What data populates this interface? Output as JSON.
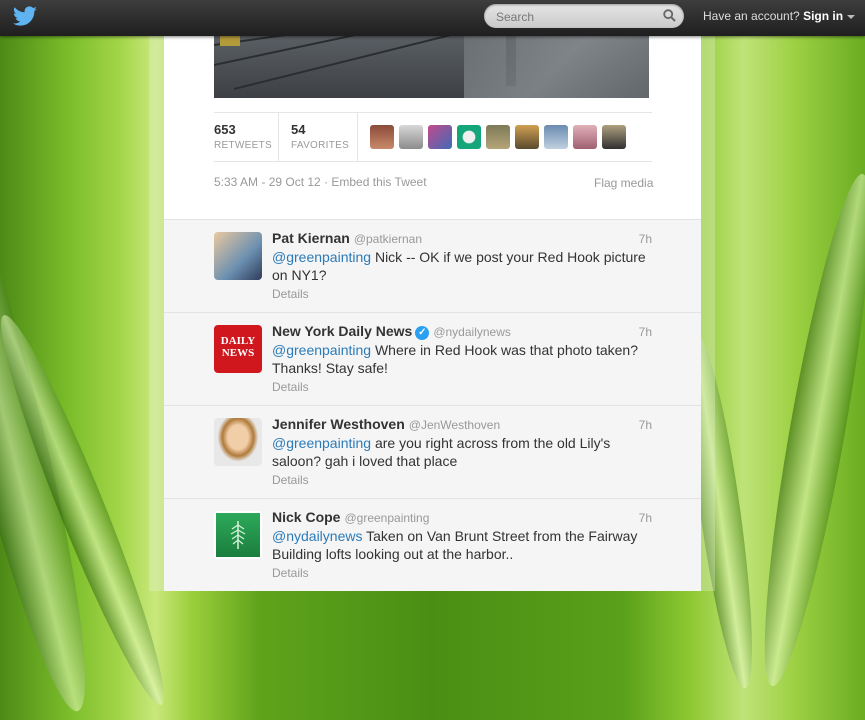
{
  "topbar": {
    "logo_icon": "twitter-bird-icon",
    "search_placeholder": "Search",
    "account_text": "Have an account?",
    "signin_label": "Sign in"
  },
  "tweet": {
    "retweets_count": "653",
    "retweets_label": "RETWEETS",
    "favorites_count": "54",
    "favorites_label": "FAVORITES",
    "timestamp_and_embed": "5:33 AM - 29 Oct 12 · Embed this Tweet",
    "flag_label": "Flag media"
  },
  "replies": [
    {
      "name": "Pat Kiernan",
      "handle": "@patkiernan",
      "time": "7h",
      "mention": "@greenpainting",
      "text": " Nick -- OK if we post your Red Hook picture on NY1?",
      "details": "Details",
      "verified": false
    },
    {
      "name": "New York Daily News",
      "handle": "@nydailynews",
      "time": "7h",
      "mention": "@greenpainting",
      "text": " Where in Red Hook was that photo taken? Thanks! Stay safe!",
      "details": "Details",
      "verified": true,
      "avatar_text": "DAILY NEWS"
    },
    {
      "name": "Jennifer Westhoven",
      "handle": "@JenWesthoven",
      "time": "7h",
      "mention": "@greenpainting",
      "text": " are you right across from the old Lily's saloon? gah i loved that place",
      "details": "Details",
      "verified": false
    },
    {
      "name": "Nick Cope",
      "handle": "@greenpainting",
      "time": "7h",
      "mention": "@nydailynews",
      "text": " Taken on Van Brunt Street from the Fairway Building lofts looking out at the harbor..",
      "details": "Details",
      "verified": false
    }
  ],
  "colors": {
    "accent": "#2b7bb9",
    "verified": "#2b9ff0",
    "topbar": "#2a2a2a"
  }
}
